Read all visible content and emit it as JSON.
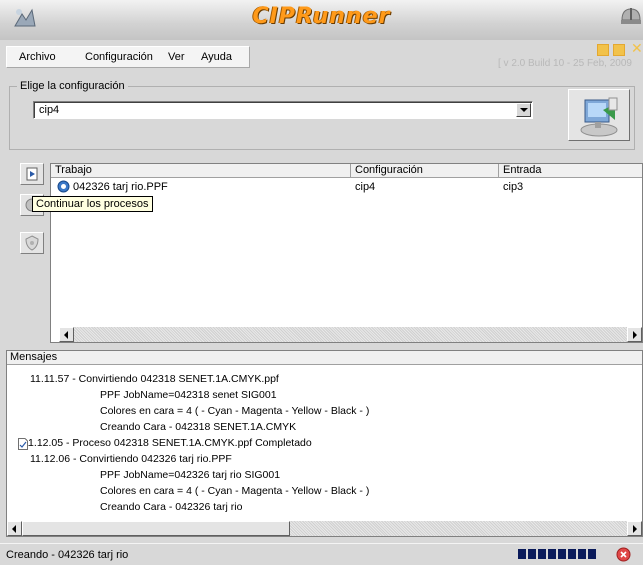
{
  "window": {
    "title": "CIPRunner",
    "version": "[ v 2.0 Build 10 - 25 Feb, 2009"
  },
  "menu": {
    "items": [
      "Archivo",
      "Configuración",
      "Ver",
      "Ayuda"
    ]
  },
  "config": {
    "legend": "Elige la configuración",
    "selected": "cip4"
  },
  "jobs": {
    "columns": [
      "Trabajo",
      "Configuración",
      "Entrada"
    ],
    "rows": [
      {
        "trabajo": "042326 tarj rio.PPF",
        "configuracion": "cip4",
        "entrada": "cip3"
      }
    ]
  },
  "tooltip": "Continuar los procesos",
  "messages": {
    "header": "Mensajes",
    "lines": [
      "11.11.57 - Convirtiendo 042318 SENET.1A.CMYK.ppf",
      "PPF JobName=042318 senet SIG001",
      "Colores en cara = 4 ( - Cyan - Magenta - Yellow - Black - )",
      "Creando Cara - 042318 SENET.1A.CMYK",
      "11.12.05 - Proceso 042318 SENET.1A.CMYK.ppf Completado",
      "11.12.06 - Convirtiendo 042326 tarj rio.PPF",
      "PPF JobName=042326 tarj rio SIG001",
      "Colores en cara = 4 ( - Cyan - Magenta - Yellow - Black - )",
      "Creando Cara - 042326 tarj rio"
    ]
  },
  "status": {
    "text": "Creando - 042326 tarj rio",
    "progress_blocks": 8
  },
  "colors": {
    "title_accent": "#ff9a1a",
    "window_button": "#f2c24a",
    "progress": "#0a1a5a"
  }
}
